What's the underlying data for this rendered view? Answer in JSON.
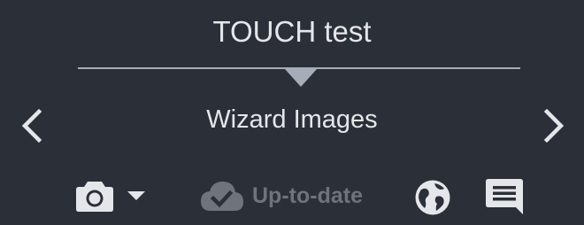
{
  "header": {
    "title": "TOUCH test"
  },
  "section": {
    "label": "Wizard Images",
    "prev_icon": "chevron-left-icon",
    "next_icon": "chevron-right-icon"
  },
  "toolbar": {
    "camera_icon": "camera-icon",
    "camera_menu_icon": "caret-down-icon",
    "sync_icon": "cloud-check-icon",
    "sync_status": "Up-to-date",
    "globe_icon": "globe-icon",
    "comment_icon": "comment-icon"
  },
  "colors": {
    "background": "#2b2f38",
    "text": "#e4e6ea",
    "divider": "#a7adb8",
    "muted": "#6e737c"
  }
}
